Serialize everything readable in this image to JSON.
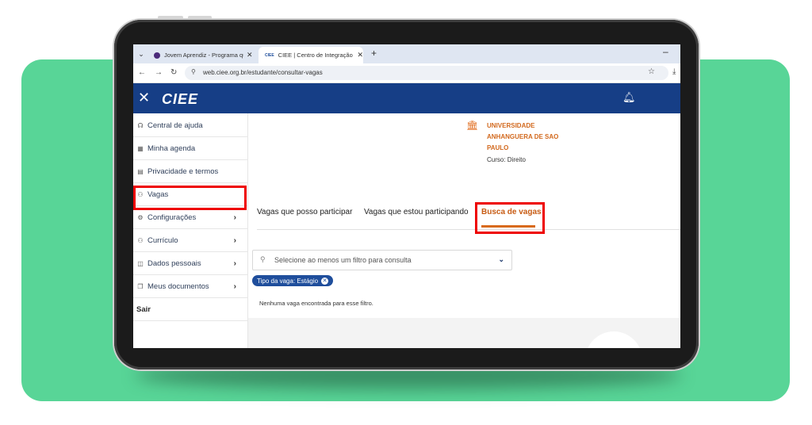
{
  "browser": {
    "tabs": [
      {
        "title": "Jovem Aprendiz - Programa que",
        "close": "✕"
      },
      {
        "favicon": "CIEE",
        "title": "CIEE | Centro de Integração Em",
        "close": "✕"
      }
    ],
    "new_tab": "+",
    "minimize": "–",
    "nav": {
      "back": "←",
      "forward": "→",
      "reload": "↻"
    },
    "url": "web.ciee.org.br/estudante/consultar-vagas"
  },
  "app": {
    "logo": "CIEE",
    "close": "✕",
    "bell": "🔔"
  },
  "sidebar": {
    "items": [
      {
        "label": "Central de ajuda",
        "icon": "headset-icon",
        "glyph": "☊"
      },
      {
        "label": "Minha agenda",
        "icon": "calendar-icon",
        "glyph": "▦"
      },
      {
        "label": "Privacidade e termos",
        "icon": "document-icon",
        "glyph": "▤"
      },
      {
        "label": "Vagas",
        "icon": "people-icon",
        "glyph": "⚇"
      },
      {
        "label": "Configurações",
        "icon": "gear-user-icon",
        "glyph": "⚙",
        "chevron": "›"
      },
      {
        "label": "Currículo",
        "icon": "resume-icon",
        "glyph": "⚇",
        "chevron": "›"
      },
      {
        "label": "Dados pessoais",
        "icon": "id-icon",
        "glyph": "◫",
        "chevron": "›"
      },
      {
        "label": "Meus documentos",
        "icon": "documents-icon",
        "glyph": "❐",
        "chevron": "›"
      },
      {
        "label": "Sair"
      }
    ]
  },
  "main": {
    "university": "UNIVERSIDADE ANHANGUERA DE SAO PAULO",
    "course": "Curso: Direito",
    "tabs": [
      {
        "label": "Vagas que posso participar"
      },
      {
        "label": "Vagas que estou participando"
      },
      {
        "label": "Busca de vagas"
      }
    ],
    "filter_placeholder": "Selecione ao menos um filtro para consulta",
    "chip": "Tipo da vaga: Estágio",
    "empty_message": "Nenhuma vaga encontrada para esse filtro."
  },
  "colors": {
    "background_green": "#58d597",
    "header_blue": "#163e86",
    "accent_orange": "#d86a1a",
    "highlight_red": "#ee0000"
  }
}
